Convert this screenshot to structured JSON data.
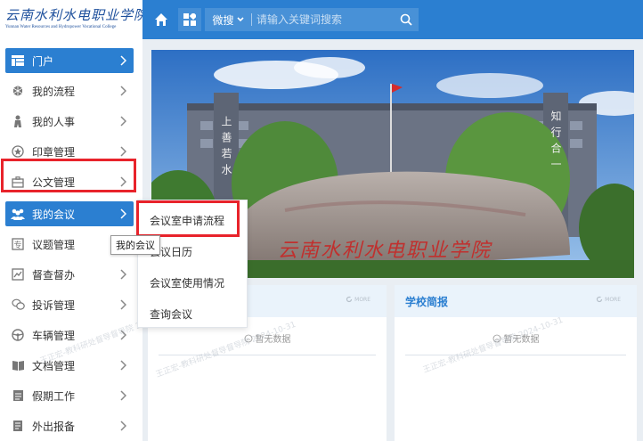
{
  "logo": {
    "name": "云南水利水电职业学院",
    "name_en": "Yunnan Water Resources and Hydropower Vocational College"
  },
  "topbar": {
    "search_scope": "微搜",
    "search_placeholder": "请输入关键词搜索"
  },
  "sidebar": {
    "items": [
      {
        "label": "门户",
        "icon": "portal-icon"
      },
      {
        "label": "我的流程",
        "icon": "workflow-icon"
      },
      {
        "label": "我的人事",
        "icon": "person-icon"
      },
      {
        "label": "印章管理",
        "icon": "seal-icon"
      },
      {
        "label": "公文管理",
        "icon": "briefcase-icon"
      },
      {
        "label": "我的会议",
        "icon": "meeting-icon"
      },
      {
        "label": "议题管理",
        "icon": "topic-icon"
      },
      {
        "label": "督查督办",
        "icon": "chart-icon"
      },
      {
        "label": "投诉管理",
        "icon": "chat-icon"
      },
      {
        "label": "车辆管理",
        "icon": "steering-wheel-icon"
      },
      {
        "label": "文档管理",
        "icon": "book-icon"
      },
      {
        "label": "假期工作",
        "icon": "calendar-icon"
      },
      {
        "label": "外出报备",
        "icon": "document-icon"
      }
    ],
    "active_index": 5
  },
  "submenu": {
    "items": [
      "会议室申请流程",
      "会议日历",
      "会议室使用情况",
      "查询会议"
    ],
    "tooltip": "我的会议"
  },
  "banner": {
    "left_text": "上善若水",
    "right_text": "知行合一",
    "rock_text": "云南水利水电职业学院"
  },
  "panels": {
    "right_title": "学校简报",
    "more_label": "MORE",
    "empty_text": "暂无数据"
  },
  "watermark": {
    "name": "王正宏-教科研处督导督导院",
    "date": "2024-10-31"
  },
  "colors": {
    "primary": "#2b7fd1",
    "highlight_box": "#e8232b"
  }
}
